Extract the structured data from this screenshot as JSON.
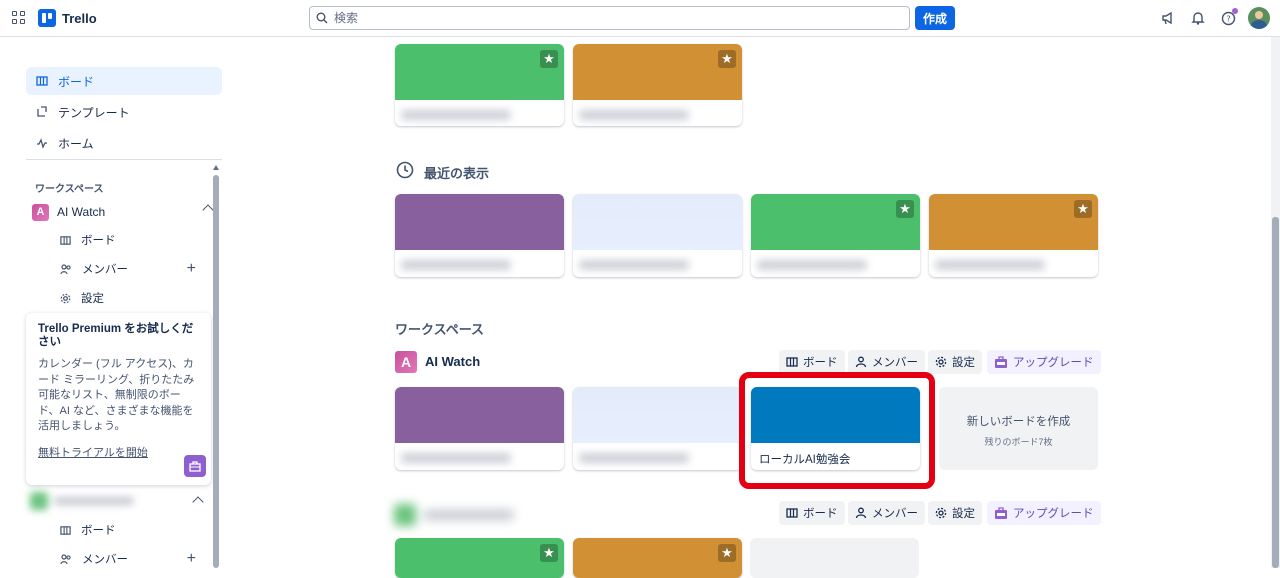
{
  "header": {
    "app_name": "Trello",
    "search_placeholder": "検索",
    "create_label": "作成",
    "icons": [
      "apps-grid-icon",
      "megaphone-icon",
      "bell-icon",
      "help-icon",
      "avatar"
    ]
  },
  "sidebar": {
    "nav": [
      {
        "label": "ボード",
        "icon": "board-icon",
        "active": true
      },
      {
        "label": "テンプレート",
        "icon": "template-icon",
        "active": false
      },
      {
        "label": "ホーム",
        "icon": "activity-icon",
        "active": false
      }
    ],
    "workspaces_heading": "ワークスペース",
    "workspace": {
      "badge": "A",
      "name": "AI Watch",
      "items": [
        {
          "label": "ボード",
          "icon": "board-icon"
        },
        {
          "label": "メンバー",
          "icon": "members-icon"
        },
        {
          "label": "設定",
          "icon": "gear-icon"
        }
      ]
    },
    "premium": {
      "title": "Trello Premium をお試しください",
      "body": "カレンダー (フル アクセス)、カード ミラーリング、折りたたみ可能なリスト、無制限のボード、AI など、さまざまな機能を活用しましょう。",
      "link": "無料トライアルを開始"
    },
    "workspace2_items": [
      {
        "label": "ボード",
        "icon": "board-icon"
      },
      {
        "label": "メンバー",
        "icon": "members-icon"
      }
    ]
  },
  "main": {
    "recent_title": "最近の表示",
    "workspaces_title": "ワークスペース",
    "workspace": {
      "badge": "A",
      "name": "AI Watch",
      "buttons": {
        "boards": "ボード",
        "members": "メンバー",
        "settings": "設定",
        "upgrade": "アップグレード"
      },
      "highlighted_board": "ローカルAI勉強会",
      "new_board": {
        "title": "新しいボードを作成",
        "remaining": "残りのボード7枚"
      }
    },
    "workspace2_buttons": {
      "boards": "ボード",
      "members": "メンバー",
      "settings": "設定",
      "upgrade": "アップグレード"
    },
    "colors": {
      "green": "#4bbf6b",
      "orange": "#d29034",
      "purple": "#89609e",
      "blue": "#0079bf",
      "highlight": "#e40012"
    }
  }
}
